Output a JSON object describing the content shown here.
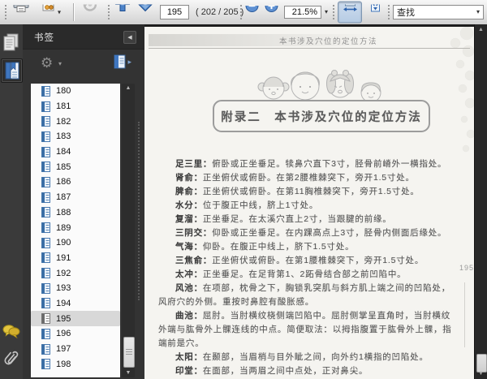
{
  "toolbar": {
    "page_value": "195",
    "page_count_label": "( 202 / 205 )",
    "zoom_value": "21.5%",
    "search_value": "查找"
  },
  "icons": {
    "collapse_left": "◀",
    "gear": "⚙",
    "dropdown": "▾",
    "scroll_up": "▲",
    "scroll_down": "▼",
    "expand_right": "▸"
  },
  "sidebar": {
    "panel_title": "书签",
    "selected_label": "195",
    "items": [
      "180",
      "181",
      "182",
      "183",
      "184",
      "185",
      "186",
      "187",
      "188",
      "189",
      "190",
      "191",
      "192",
      "193",
      "194",
      "195",
      "196",
      "197",
      "198"
    ]
  },
  "page": {
    "running_header": "本书涉及穴位的定位方法",
    "title": "附录二　本书涉及穴位的定位方法",
    "margin_page_number": "195",
    "entries": [
      {
        "term": "足三里：",
        "text": "俯卧或正坐垂足。犊鼻穴直下3寸，胫骨前嵴外一横指处。"
      },
      {
        "term": "肾俞：",
        "text": "正坐俯伏或俯卧。在第2腰椎棘突下，旁开1.5寸处。"
      },
      {
        "term": "脾俞：",
        "text": "正坐俯伏或俯卧。在第11胸椎棘突下，旁开1.5寸处。"
      },
      {
        "term": "水分：",
        "text": "位于腹正中线，脐上1寸处。"
      },
      {
        "term": "复溜：",
        "text": "正坐垂足。在太溪穴直上2寸，当跟腱的前缘。"
      },
      {
        "term": "三阴交：",
        "text": "仰卧或正坐垂足。在内踝高点上3寸，胫骨内侧面后缘处。"
      },
      {
        "term": "气海：",
        "text": "仰卧。在腹正中线上，脐下1.5寸处。"
      },
      {
        "term": "三焦俞：",
        "text": "正坐俯伏或俯卧。在第1腰椎棘突下，旁开1.5寸处。"
      },
      {
        "term": "太冲：",
        "text": "正坐垂足。在足背第1、2跖骨结合部之前凹陷中。"
      },
      {
        "term": "风池：",
        "text": "在项部，枕骨之下，胸锁乳突肌与斜方肌上端之间的凹陷处，风府穴的外侧。重按时鼻腔有酸胀感。"
      },
      {
        "term": "曲池：",
        "text": "屈肘。当肘横纹桡侧端凹陷中。屈肘侧掌呈直角时，当肘横纹外端与肱骨外上髁连线的中点。简便取法：以拇指腹置于肱骨外上髁，指端前是穴。"
      },
      {
        "term": "太阳：",
        "text": "在颞部，当眉梢与目外眦之间，向外约1横指的凹陷处。"
      },
      {
        "term": "印堂：",
        "text": "在面部，当两眉之间中点处，正对鼻尖。"
      }
    ]
  },
  "colors": {
    "accent_blue": "#3a72b8",
    "toolbar_bg": "#e3e3e3",
    "sidebar_bg": "#333333",
    "doc_bg": "#1d1d1d",
    "page_bg": "#f5f4f0",
    "selection_bg": "#d8d8d8"
  }
}
